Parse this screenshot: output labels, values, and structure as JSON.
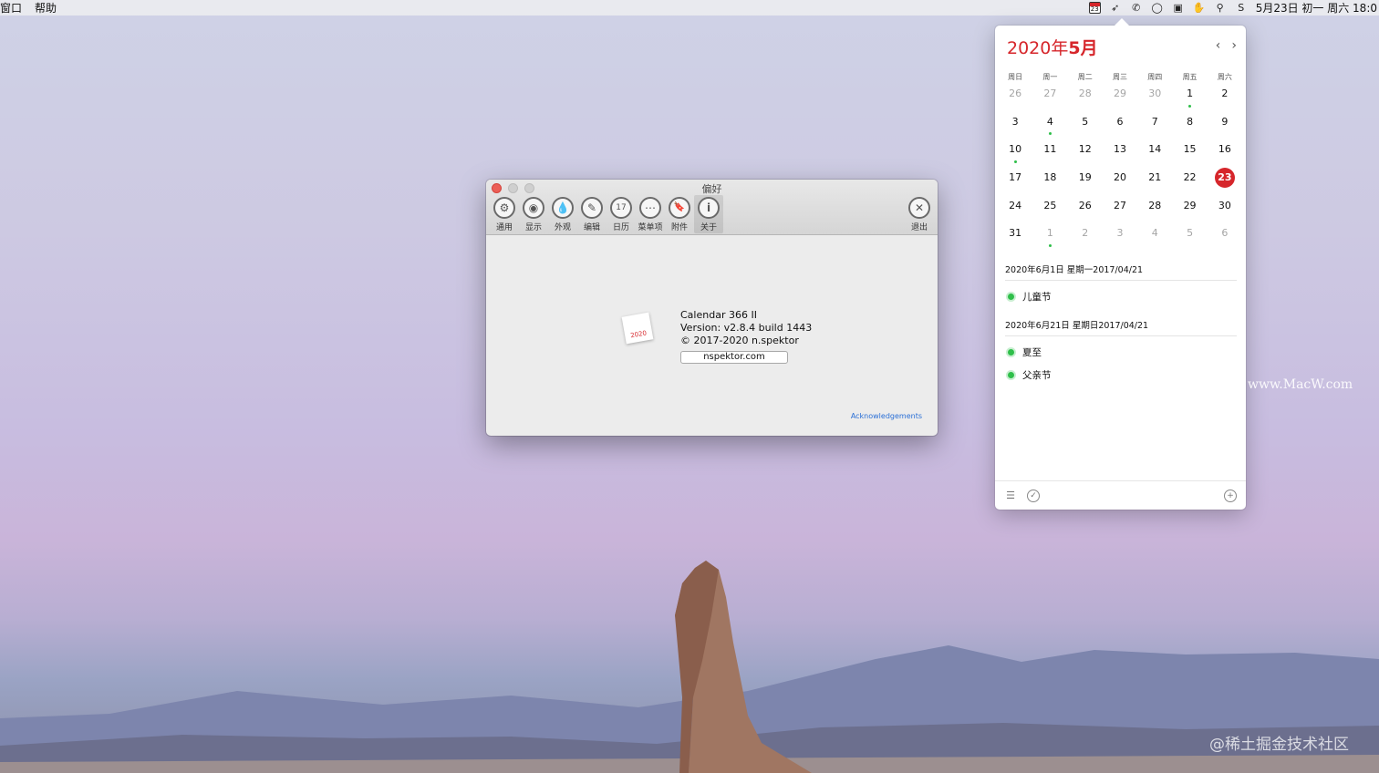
{
  "menubar": {
    "menus": [
      "窗口",
      "帮助"
    ],
    "calendar_icon_day": "23",
    "status_icons": [
      "bird-icon",
      "wechat-icon",
      "chat-icon",
      "screen-icon",
      "hand-icon",
      "pin-icon",
      "s-icon"
    ],
    "clock": "5月23日 初一 周六 18:0"
  },
  "prefs": {
    "title": "偏好",
    "tools": [
      {
        "label": "通用",
        "icon": "⚙"
      },
      {
        "label": "显示",
        "icon": "◉"
      },
      {
        "label": "外观",
        "icon": "💧"
      },
      {
        "label": "编辑",
        "icon": "✎"
      },
      {
        "label": "日历",
        "icon": "17"
      },
      {
        "label": "菜单项",
        "icon": "⋯"
      },
      {
        "label": "附件",
        "icon": "🔖"
      },
      {
        "label": "关于",
        "icon": "i"
      }
    ],
    "quit": {
      "label": "退出",
      "icon": "✕"
    },
    "app_icon_text": "2020",
    "about": {
      "name": "Calendar 366 II",
      "version": "Version: v2.8.4 build 1443",
      "copyright": "© 2017-2020 n.spektor",
      "website": "nspektor.com"
    },
    "acknowledgements": "Acknowledgements"
  },
  "calendar": {
    "month_year": "2020年",
    "month": "5月",
    "prev": "‹",
    "next": "›",
    "weekdays": [
      "周日",
      "周一",
      "周二",
      "周三",
      "周四",
      "周五",
      "周六"
    ],
    "days": [
      {
        "d": "26",
        "muted": true
      },
      {
        "d": "27",
        "muted": true
      },
      {
        "d": "28",
        "muted": true
      },
      {
        "d": "29",
        "muted": true
      },
      {
        "d": "30",
        "muted": true
      },
      {
        "d": "1",
        "dot": true
      },
      {
        "d": "2"
      },
      {
        "d": "3"
      },
      {
        "d": "4",
        "dot": true
      },
      {
        "d": "5"
      },
      {
        "d": "6"
      },
      {
        "d": "7"
      },
      {
        "d": "8"
      },
      {
        "d": "9"
      },
      {
        "d": "10",
        "dot": true
      },
      {
        "d": "11"
      },
      {
        "d": "12"
      },
      {
        "d": "13"
      },
      {
        "d": "14"
      },
      {
        "d": "15"
      },
      {
        "d": "16"
      },
      {
        "d": "17"
      },
      {
        "d": "18"
      },
      {
        "d": "19"
      },
      {
        "d": "20"
      },
      {
        "d": "21"
      },
      {
        "d": "22"
      },
      {
        "d": "23",
        "today": true
      },
      {
        "d": "24"
      },
      {
        "d": "25"
      },
      {
        "d": "26"
      },
      {
        "d": "27"
      },
      {
        "d": "28"
      },
      {
        "d": "29"
      },
      {
        "d": "30"
      },
      {
        "d": "31"
      },
      {
        "d": "1",
        "muted": true,
        "dot": true
      },
      {
        "d": "2",
        "muted": true
      },
      {
        "d": "3",
        "muted": true
      },
      {
        "d": "4",
        "muted": true
      },
      {
        "d": "5",
        "muted": true
      },
      {
        "d": "6",
        "muted": true
      }
    ],
    "event_groups": [
      {
        "header": "2020年6月1日 星期一2017/04/21",
        "items": [
          "儿童节"
        ]
      },
      {
        "header": "2020年6月21日 星期日2017/04/21",
        "items": [
          "夏至",
          "父亲节"
        ]
      }
    ],
    "accent_color": "#d6262b",
    "event_color": "#2fbf4a"
  },
  "watermarks": {
    "macw": "www.MacW.com",
    "juejin": "@稀土掘金技术社区"
  }
}
